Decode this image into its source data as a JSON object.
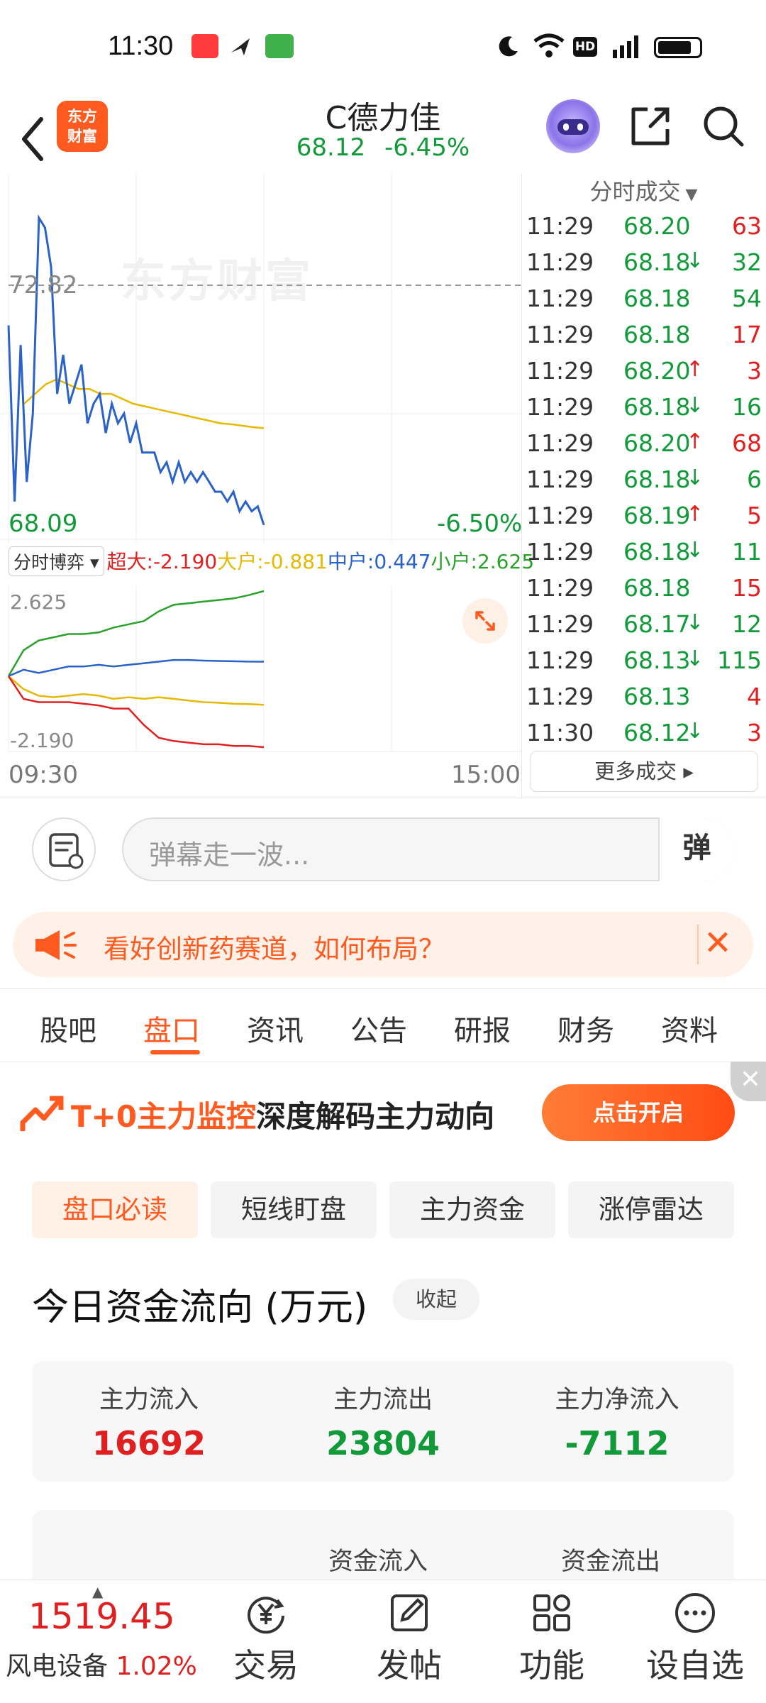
{
  "status_bar": {
    "time": "11:30"
  },
  "header": {
    "logo_text": [
      "东方",
      "财富"
    ],
    "stock_name": "C德力佳",
    "price": "68.12",
    "change_pct": "-6.45%"
  },
  "chart": {
    "watermark": "东方财富",
    "ref_price": "72.82",
    "low_price": "68.09",
    "low_pct": "-6.50%",
    "time_start": "09:30",
    "time_end": "15:00",
    "colors": {
      "price": "#2a62c9",
      "avg": "#e6b800",
      "ref": "#999999"
    },
    "price_series": [
      72.2,
      68.6,
      71.8,
      69.0,
      70.4,
      74.4,
      74.2,
      73.4,
      70.8,
      71.6,
      70.6,
      71.0,
      71.4,
      70.2,
      70.6,
      70.8,
      70.0,
      70.6,
      70.2,
      70.4,
      69.8,
      70.2,
      69.6,
      69.6,
      69.6,
      69.2,
      69.4,
      69.0,
      69.4,
      69.0,
      69.2,
      69.0,
      69.2,
      69.0,
      68.8,
      68.8,
      68.6,
      68.8,
      68.4,
      68.6,
      68.4,
      68.5,
      68.12
    ],
    "avg_series": [
      70.6,
      70.8,
      71.0,
      71.1,
      71.0,
      70.9,
      70.9,
      70.8,
      70.8,
      70.7,
      70.6,
      70.55,
      70.5,
      70.45,
      70.4,
      70.35,
      70.3,
      70.25,
      70.2,
      70.18,
      70.15,
      70.12,
      70.1
    ],
    "ylim": [
      67.9,
      75.3
    ]
  },
  "money_game": {
    "selector": "分时博弈",
    "legend": [
      {
        "label": "超大:",
        "value": "-2.190",
        "color": "#e02020"
      },
      {
        "label": "大户:",
        "value": "-0.881",
        "color": "#e6b800"
      },
      {
        "label": "中户:",
        "value": "0.447",
        "color": "#2a62c9"
      },
      {
        "label": "小户:",
        "value": "2.625",
        "color": "#2aa12a"
      }
    ],
    "max_label": "2.625",
    "min_label": "-2.190",
    "series": {
      "super": [
        0,
        -0.7,
        -0.8,
        -0.8,
        -0.8,
        -0.85,
        -0.9,
        -1.0,
        -1.0,
        -1.5,
        -1.9,
        -2.0,
        -2.05,
        -2.1,
        -2.1,
        -2.15,
        -2.15,
        -2.19
      ],
      "big": [
        0,
        -0.4,
        -0.6,
        -0.65,
        -0.6,
        -0.55,
        -0.6,
        -0.7,
        -0.65,
        -0.7,
        -0.65,
        -0.7,
        -0.75,
        -0.8,
        -0.82,
        -0.85,
        -0.86,
        -0.881
      ],
      "mid": [
        0,
        0.2,
        0.1,
        0.2,
        0.3,
        0.3,
        0.35,
        0.3,
        0.35,
        0.4,
        0.45,
        0.5,
        0.5,
        0.48,
        0.47,
        0.46,
        0.45,
        0.447
      ],
      "small": [
        0,
        0.8,
        1.1,
        1.2,
        1.3,
        1.3,
        1.35,
        1.5,
        1.6,
        1.7,
        2.0,
        2.2,
        2.25,
        2.3,
        2.35,
        2.4,
        2.5,
        2.625
      ]
    }
  },
  "trades": {
    "header": "分时成交",
    "rows": [
      {
        "time": "11:29",
        "price": "68.20",
        "arrow": "",
        "vol": "63",
        "vol_color": "#e02020"
      },
      {
        "time": "11:29",
        "price": "68.18",
        "arrow": "↓",
        "vol": "32",
        "vol_color": "#129a3a"
      },
      {
        "time": "11:29",
        "price": "68.18",
        "arrow": "",
        "vol": "54",
        "vol_color": "#129a3a"
      },
      {
        "time": "11:29",
        "price": "68.18",
        "arrow": "",
        "vol": "17",
        "vol_color": "#e02020"
      },
      {
        "time": "11:29",
        "price": "68.20",
        "arrow": "↑",
        "vol": "3",
        "vol_color": "#e02020"
      },
      {
        "time": "11:29",
        "price": "68.18",
        "arrow": "↓",
        "vol": "16",
        "vol_color": "#129a3a"
      },
      {
        "time": "11:29",
        "price": "68.20",
        "arrow": "↑",
        "vol": "68",
        "vol_color": "#e02020"
      },
      {
        "time": "11:29",
        "price": "68.18",
        "arrow": "↓",
        "vol": "6",
        "vol_color": "#129a3a"
      },
      {
        "time": "11:29",
        "price": "68.19",
        "arrow": "↑",
        "vol": "5",
        "vol_color": "#e02020"
      },
      {
        "time": "11:29",
        "price": "68.18",
        "arrow": "↓",
        "vol": "11",
        "vol_color": "#129a3a"
      },
      {
        "time": "11:29",
        "price": "68.18",
        "arrow": "",
        "vol": "15",
        "vol_color": "#e02020"
      },
      {
        "time": "11:29",
        "price": "68.17",
        "arrow": "↓",
        "vol": "12",
        "vol_color": "#129a3a"
      },
      {
        "time": "11:29",
        "price": "68.13",
        "arrow": "↓",
        "vol": "115",
        "vol_color": "#129a3a"
      },
      {
        "time": "11:29",
        "price": "68.13",
        "arrow": "",
        "vol": "4",
        "vol_color": "#e02020"
      },
      {
        "time": "11:30",
        "price": "68.12",
        "arrow": "↓",
        "vol": "3",
        "vol_color": "#e02020"
      }
    ],
    "more_label": "更多成交"
  },
  "comment": {
    "placeholder": "弹幕走一波...",
    "danmu_button": "弹"
  },
  "promo": {
    "text": "看好创新药赛道，如何布局？"
  },
  "tabs": [
    "股吧",
    "盘口",
    "资讯",
    "公告",
    "研报",
    "财务",
    "资料"
  ],
  "active_tab": "盘口",
  "monitor": {
    "title_highlight": "T+0主力监控",
    "title_rest": "深度解码主力动向",
    "button": "点击开启"
  },
  "subtabs": [
    "盘口必读",
    "短线盯盘",
    "主力资金",
    "涨停雷达"
  ],
  "fund_flow": {
    "title": "今日资金流向 (万元)",
    "collapse": "收起",
    "items": [
      {
        "label": "主力流入",
        "value": "16692",
        "color": "#e02020"
      },
      {
        "label": "主力流出",
        "value": "23804",
        "color": "#129a3a"
      },
      {
        "label": "主力净流入",
        "value": "-7112",
        "color": "#129a3a"
      }
    ],
    "card2_labels": [
      "资金流入",
      "资金流出"
    ]
  },
  "bottom_nav": {
    "index_value": "1519.45",
    "index_name": "风电设备",
    "index_pct": "1.02%",
    "items": [
      {
        "label": "交易",
        "icon": "yen-trade-icon"
      },
      {
        "label": "发帖",
        "icon": "edit-post-icon"
      },
      {
        "label": "功能",
        "icon": "grid-functions-icon"
      },
      {
        "label": "设自选",
        "icon": "more-dots-icon"
      }
    ]
  }
}
